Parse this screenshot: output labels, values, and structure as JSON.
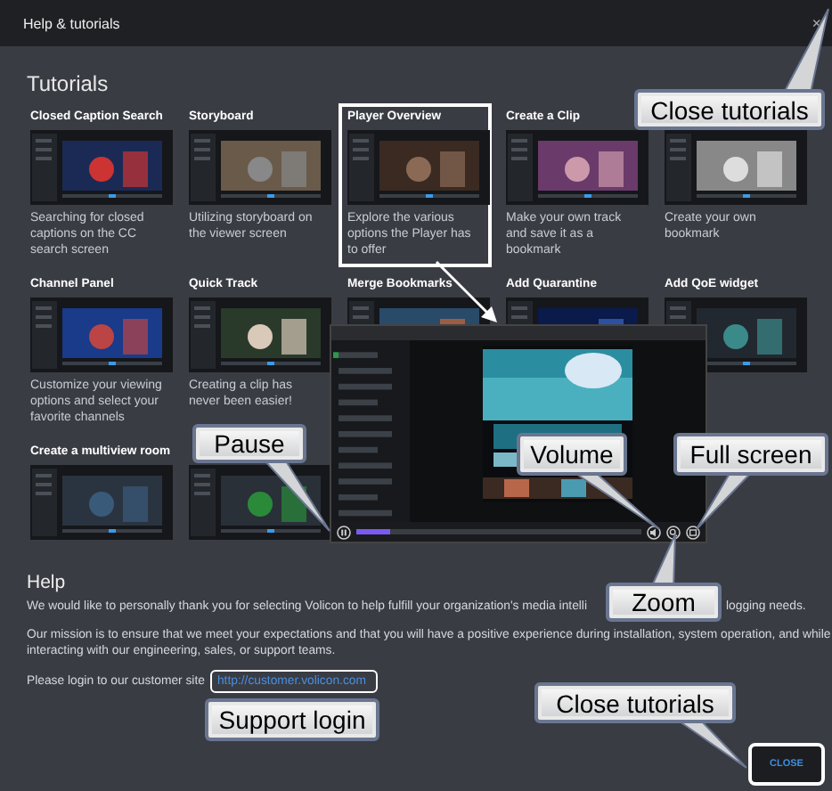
{
  "window": {
    "title": "Help & tutorials",
    "close_symbol": "×"
  },
  "tutorials": {
    "heading": "Tutorials",
    "cards": [
      {
        "title": "Closed Caption Search",
        "description": "Searching for closed captions on the CC search screen",
        "selected": false
      },
      {
        "title": "Storyboard",
        "description": "Utilizing storyboard on the viewer screen",
        "selected": false
      },
      {
        "title": "Player Overview",
        "description": "Explore the various options the Player has to offer",
        "selected": true
      },
      {
        "title": "Create a Clip",
        "description": "Make your own track and save it as a bookmark",
        "selected": false
      },
      {
        "description": "Create your own bookmark",
        "selected": false
      },
      {
        "title": "Channel Panel",
        "description": "Customize your viewing options and select your favorite channels",
        "selected": false
      },
      {
        "title": "Quick Track",
        "description": "Creating a clip has never been easier!",
        "selected": false
      },
      {
        "title": "Merge Bookmarks",
        "selected": false
      },
      {
        "title": "Add Quarantine",
        "selected": false
      },
      {
        "title": "Add QoE widget",
        "selected": false
      },
      {
        "title": "Create a multiview room",
        "selected": false
      },
      {
        "selected": false
      }
    ]
  },
  "player_preview": {
    "progress": {
      "level": 0.12
    }
  },
  "help": {
    "heading": "Help",
    "thanks_parts": [
      "We would like to personally thank you for selecting Volicon to help fulfill your organization's media intelli",
      "logging needs."
    ],
    "mission": "Our mission is to ensure that we meet your expectations and that you will have a positive experience during installation, system operation, and while interacting with our engineering, sales, or support teams.",
    "login_prompt": "Please login to our customer site",
    "login_link": "http://customer.volicon.com"
  },
  "close_button": "CLOSE",
  "callouts": [
    {
      "label": "Close tutorials"
    },
    {
      "label": "Pause"
    },
    {
      "label": "Volume"
    },
    {
      "label": "Full screen"
    },
    {
      "label": "Zoom"
    },
    {
      "label": "Support login"
    },
    {
      "label": "Close tutorials"
    }
  ]
}
